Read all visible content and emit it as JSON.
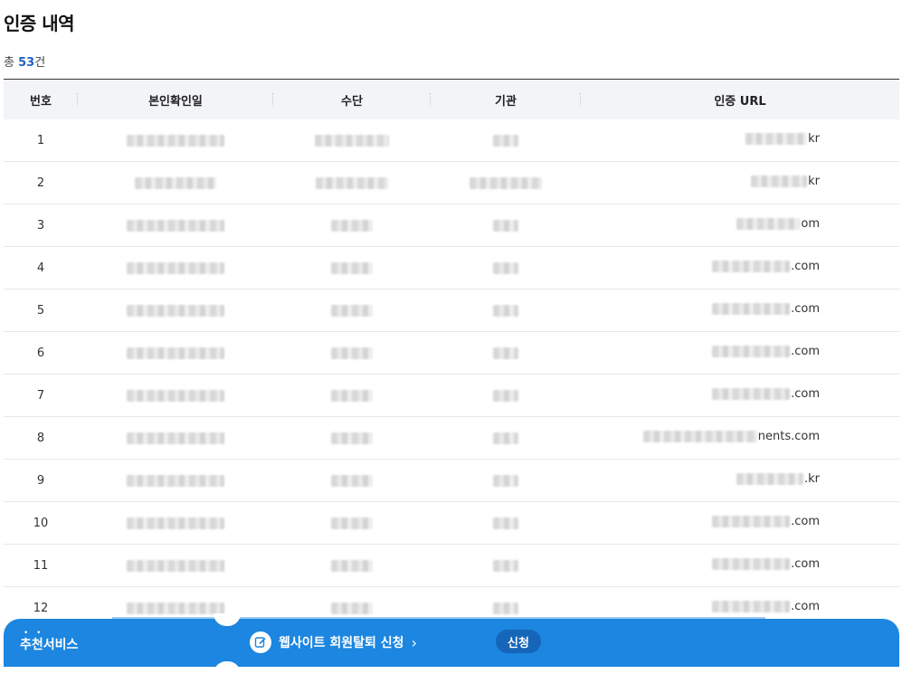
{
  "page": {
    "title": "인증 내역"
  },
  "summary": {
    "prefix": "총 ",
    "count": "53",
    "suffix": "건"
  },
  "table": {
    "columns": [
      "번호",
      "본인확인일",
      "수단",
      "기관",
      "인증 URL"
    ],
    "rows": [
      {
        "no": "1",
        "url_suffix": "kr"
      },
      {
        "no": "2",
        "url_suffix": "kr"
      },
      {
        "no": "3",
        "url_suffix": "om"
      },
      {
        "no": "4",
        "url_suffix": ".com"
      },
      {
        "no": "5",
        "url_suffix": ".com"
      },
      {
        "no": "6",
        "url_suffix": ".com"
      },
      {
        "no": "7",
        "url_suffix": ".com"
      },
      {
        "no": "8",
        "url_suffix": "nents.com"
      },
      {
        "no": "9",
        "url_suffix": ".kr"
      },
      {
        "no": "10",
        "url_suffix": ".com"
      },
      {
        "no": "11",
        "url_suffix": ".com"
      },
      {
        "no": "12",
        "url_suffix": ".com"
      }
    ]
  },
  "bottom_bar": {
    "recommend_label": "추천서비스",
    "promo_text": "웹사이트 회원탈퇴 신청",
    "apply_label": "신청",
    "icons": [
      "edit-icon",
      "chevron-right-icon"
    ]
  },
  "colors": {
    "accent": "#1c86e0",
    "count": "#1f63c4",
    "header_bg": "#f2f4f7"
  }
}
